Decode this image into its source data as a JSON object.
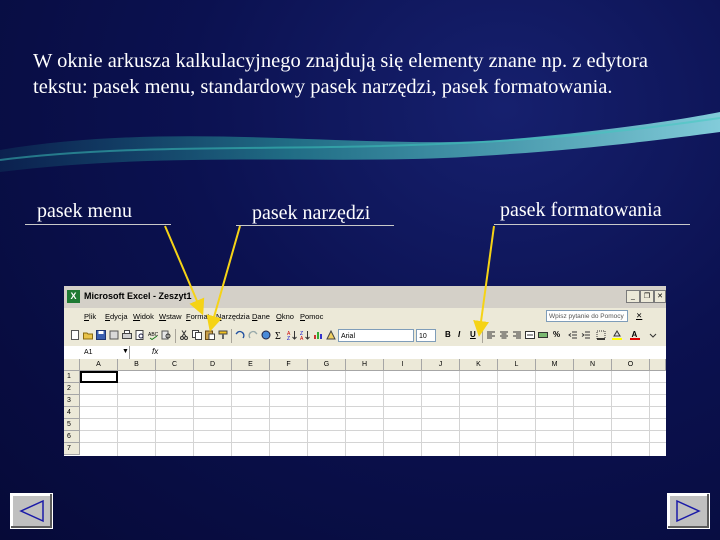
{
  "slide": {
    "intro_text": "W oknie arkusza kalkulacyjnego znajdują się elementy znane np. z edytora tekstu: pasek menu, standardowy pasek narzędzi, pasek formatowania.",
    "labels": {
      "menu": "pasek menu",
      "toolbar": "pasek narzędzi",
      "formatting": "pasek formatowania"
    },
    "colors": {
      "background": "#0b1150",
      "arrow": "#f5d316",
      "text": "#ffffff"
    }
  },
  "excel": {
    "title": "Microsoft Excel - Zeszyt1",
    "app_icon": "X",
    "menu": [
      "Plik",
      "Edycja",
      "Widok",
      "Wstaw",
      "Format",
      "Narzędzia",
      "Dane",
      "Okno",
      "Pomoc"
    ],
    "help_placeholder": "Wpisz pytanie do Pomocy",
    "font_name": "Arial",
    "font_size": "10",
    "format_buttons": [
      "B",
      "I",
      "U"
    ],
    "percent": "%",
    "name_box": "A1",
    "fx": "fx",
    "columns": [
      "A",
      "B",
      "C",
      "D",
      "E",
      "F",
      "G",
      "H",
      "I",
      "J",
      "K",
      "L",
      "M",
      "N",
      "O"
    ],
    "rows": [
      "1",
      "2",
      "3",
      "4",
      "5",
      "6",
      "7"
    ]
  },
  "nav": {
    "prev_icon": "triangle-left-icon",
    "next_icon": "triangle-right-icon"
  }
}
